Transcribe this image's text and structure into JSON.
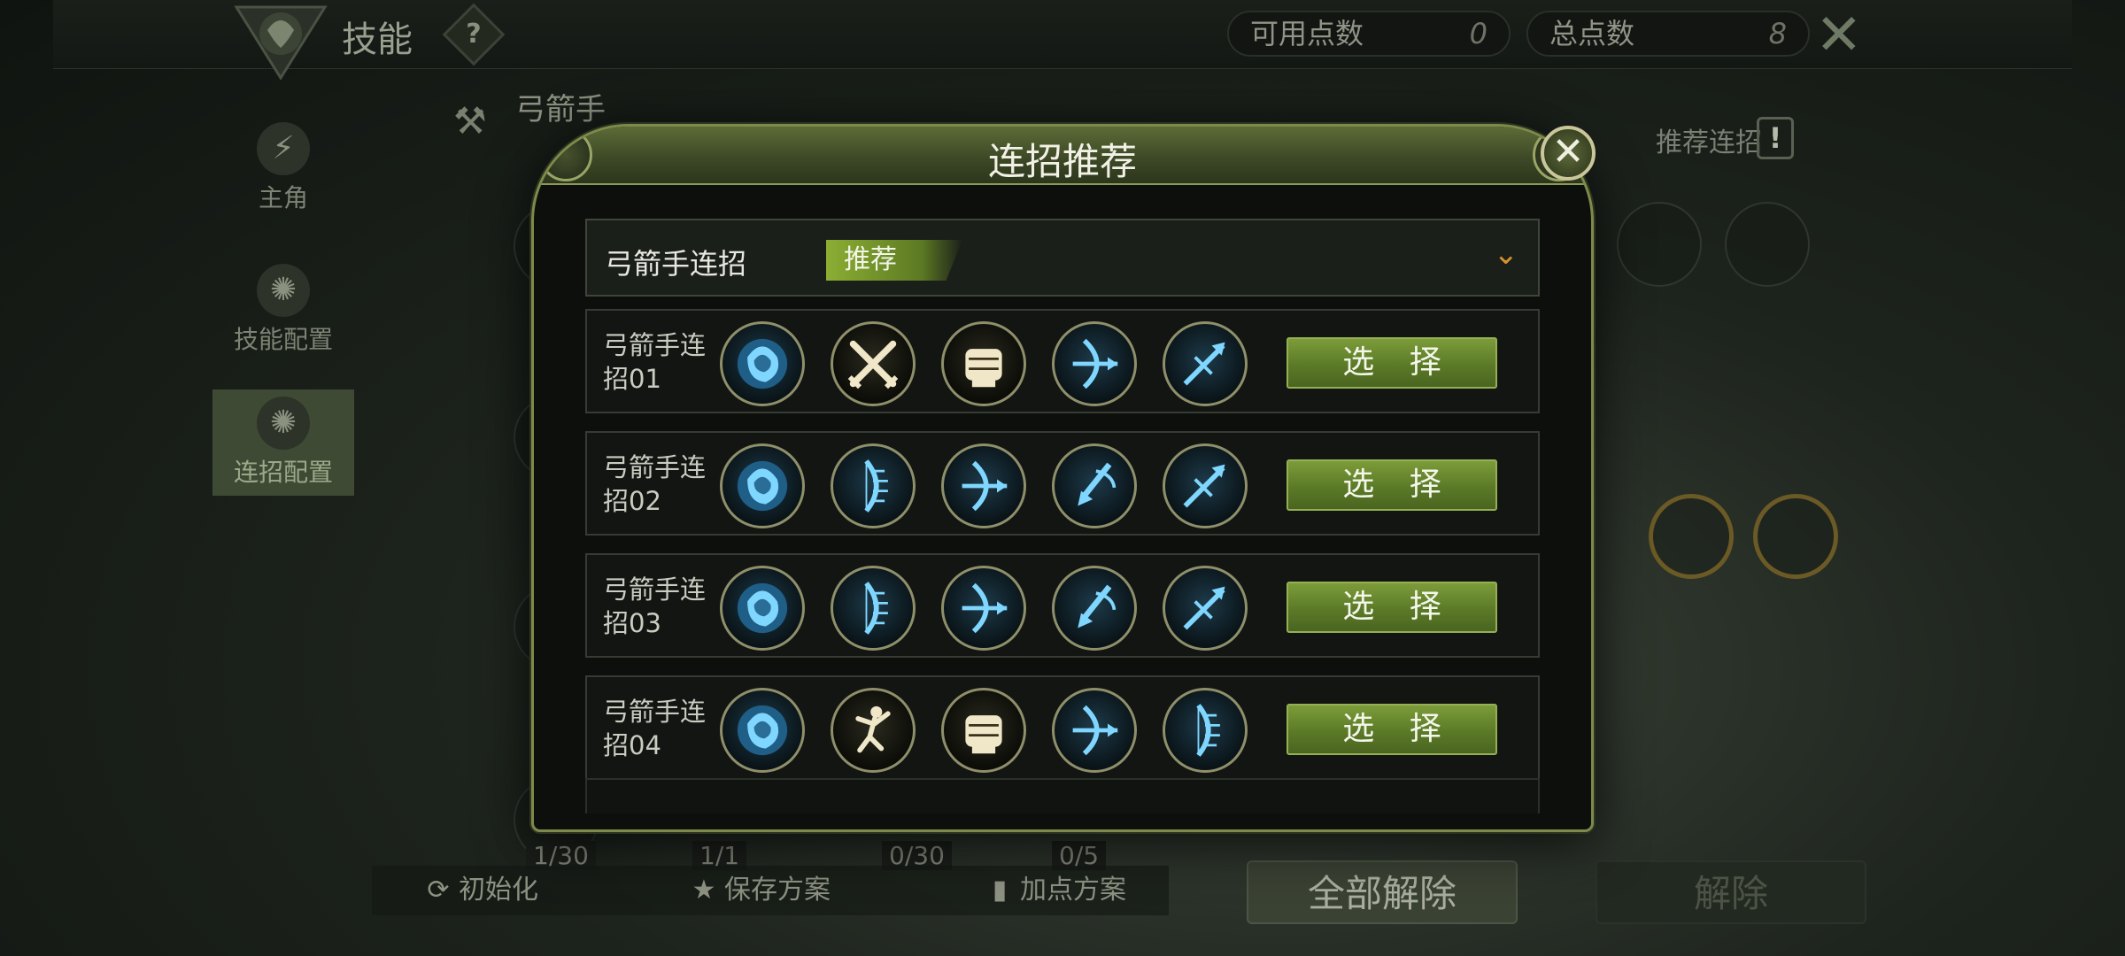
{
  "background": {
    "title": "技能",
    "help_icon": "?",
    "available_points_label": "可用点数",
    "available_points_value": "0",
    "total_points_label": "总点数",
    "total_points_value": "8",
    "class_name": "弓箭手",
    "side_nav": [
      {
        "label": "主角",
        "icon": "lightning-icon"
      },
      {
        "label": "技能配置",
        "icon": "swirl-icon"
      },
      {
        "label": "连招配置",
        "icon": "swirl-icon"
      }
    ],
    "recommend_combo_label": "推荐连招",
    "skill_counts": [
      "1/30",
      "1/1",
      "0/30",
      "0/5"
    ],
    "bottom_buttons": [
      {
        "label": "初始化",
        "icon": "refresh-icon"
      },
      {
        "label": "保存方案",
        "icon": "star-icon"
      },
      {
        "label": "加点方案",
        "icon": "book-icon"
      }
    ],
    "clear_all_label": "全部解除",
    "clear_label": "解除"
  },
  "modal": {
    "title": "连招推荐",
    "dropdown": {
      "label": "弓箭手连招",
      "tag": "推荐"
    },
    "select_label": "选 择",
    "combos": [
      {
        "name": "弓箭手连招01",
        "skills": [
          "dodge-swirl-icon",
          "crossed-swords-icon",
          "fist-icon",
          "bow-arrow-icon",
          "piercing-arrow-icon"
        ]
      },
      {
        "name": "弓箭手连招02",
        "skills": [
          "dodge-swirl-icon",
          "multi-bow-icon",
          "bow-arrow-icon",
          "diving-arrow-icon",
          "piercing-arrow-icon"
        ]
      },
      {
        "name": "弓箭手连招03",
        "skills": [
          "dodge-swirl-icon",
          "multi-bow-icon",
          "bow-arrow-icon",
          "diving-arrow-icon",
          "piercing-arrow-icon"
        ]
      },
      {
        "name": "弓箭手连招04",
        "skills": [
          "dodge-swirl-icon",
          "leaping-figure-icon",
          "fist-icon",
          "bow-arrow-icon",
          "multi-bow-icon"
        ]
      }
    ]
  },
  "colors": {
    "accent_green": "#7c9c3a",
    "frame_olive": "#7d8a4a",
    "dropdown_arrow": "#d8922a",
    "skill_blue": "#7fd6ff",
    "skill_gold": "#f0e6c8"
  }
}
